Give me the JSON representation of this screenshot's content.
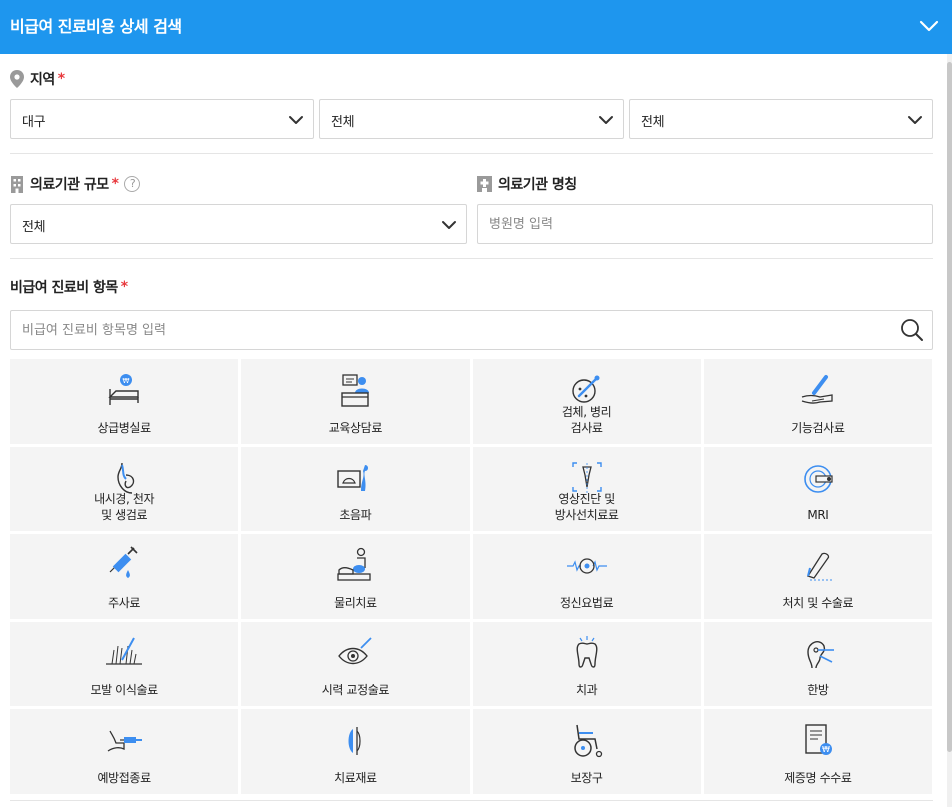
{
  "header": {
    "title": "비급여 진료비용 상세 검색"
  },
  "region": {
    "label": "지역",
    "required": "*",
    "selects": [
      "대구",
      "전체",
      "전체"
    ]
  },
  "scale": {
    "label": "의료기관 규모",
    "required": "*",
    "help": "?",
    "value": "전체"
  },
  "name": {
    "label": "의료기관 명칭",
    "placeholder": "병원명 입력"
  },
  "items": {
    "label": "비급여 진료비 항목",
    "required": "*",
    "placeholder": "비급여 진료비 항목명 입력",
    "categories": [
      {
        "label": "상급병실료",
        "icon": "hospital-bed-icon"
      },
      {
        "label": "교육상담료",
        "icon": "counseling-icon"
      },
      {
        "label": "검체, 병리\n검사료",
        "icon": "specimen-test-icon"
      },
      {
        "label": "기능검사료",
        "icon": "function-test-icon"
      },
      {
        "label": "내시경, 천자\n및 생검료",
        "icon": "endoscopy-icon"
      },
      {
        "label": "초음파",
        "icon": "ultrasound-icon"
      },
      {
        "label": "영상진단 및\n방사선치료료",
        "icon": "radiology-icon"
      },
      {
        "label": "MRI",
        "icon": "mri-icon"
      },
      {
        "label": "주사료",
        "icon": "syringe-icon"
      },
      {
        "label": "물리치료",
        "icon": "physical-therapy-icon"
      },
      {
        "label": "정신요법료",
        "icon": "psychotherapy-icon"
      },
      {
        "label": "처치 및 수술료",
        "icon": "surgery-icon"
      },
      {
        "label": "모발 이식술료",
        "icon": "hair-transplant-icon"
      },
      {
        "label": "시력 교정술료",
        "icon": "eye-correction-icon"
      },
      {
        "label": "치과",
        "icon": "tooth-icon"
      },
      {
        "label": "한방",
        "icon": "acupuncture-icon"
      },
      {
        "label": "예방접종료",
        "icon": "vaccination-icon"
      },
      {
        "label": "치료재료",
        "icon": "treatment-material-icon"
      },
      {
        "label": "보장구",
        "icon": "wheelchair-icon"
      },
      {
        "label": "제증명 수수료",
        "icon": "certificate-icon"
      }
    ]
  },
  "colors": {
    "primary": "#1e96ee",
    "required": "#e8383d",
    "tile": "#f4f4f4"
  }
}
